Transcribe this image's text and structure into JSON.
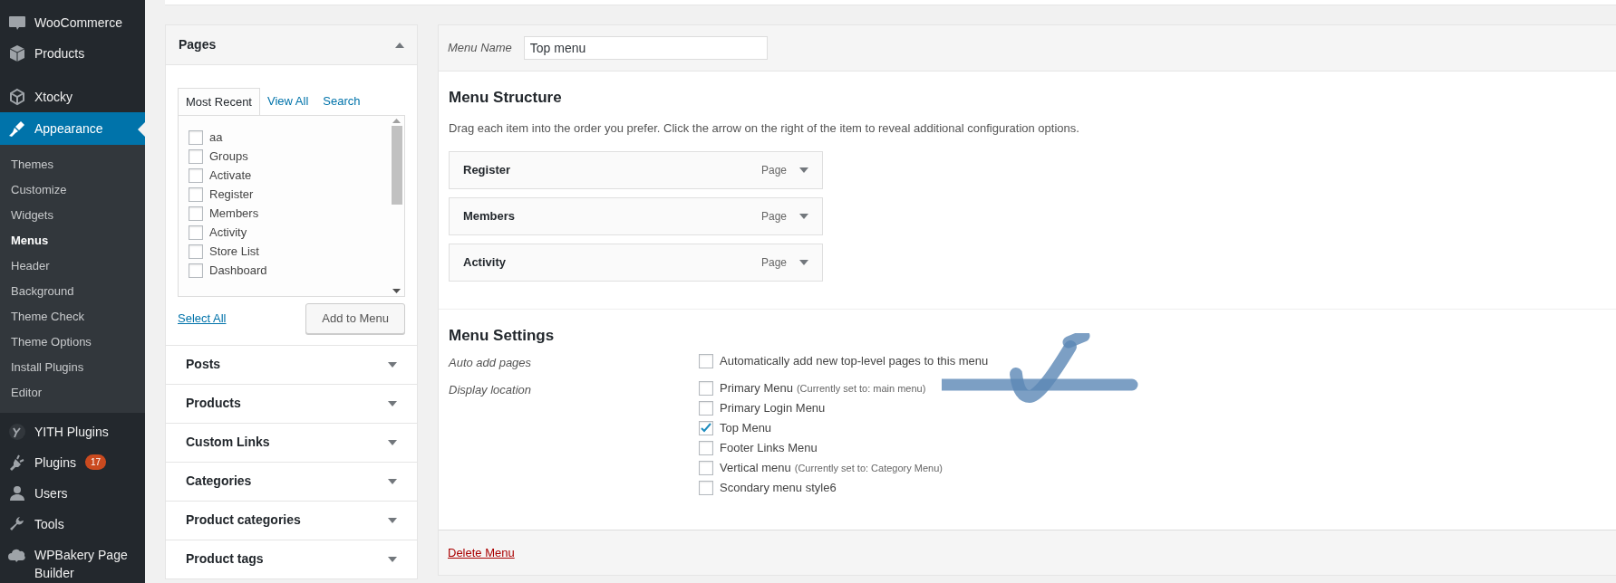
{
  "sidebar": {
    "items": [
      {
        "label": "WooCommerce",
        "selected": false
      },
      {
        "label": "Products",
        "selected": false
      },
      {
        "label": "Xtocky",
        "selected": false
      },
      {
        "label": "Appearance",
        "selected": true,
        "submenu": [
          {
            "label": "Themes",
            "selected": false
          },
          {
            "label": "Customize",
            "selected": false
          },
          {
            "label": "Widgets",
            "selected": false
          },
          {
            "label": "Menus",
            "selected": true
          },
          {
            "label": "Header",
            "selected": false
          },
          {
            "label": "Background",
            "selected": false
          },
          {
            "label": "Theme Check",
            "selected": false
          },
          {
            "label": "Theme Options",
            "selected": false
          },
          {
            "label": "Install Plugins",
            "selected": false
          },
          {
            "label": "Editor",
            "selected": false
          }
        ]
      },
      {
        "label": "YITH Plugins",
        "selected": false
      },
      {
        "label": "Plugins",
        "selected": false,
        "badge": "17"
      },
      {
        "label": "Users",
        "selected": false
      },
      {
        "label": "Tools",
        "selected": false
      },
      {
        "label": "WPBakery Page Builder",
        "selected": false
      }
    ]
  },
  "pages_box": {
    "title": "Pages",
    "expanded": true,
    "tabs": [
      {
        "label": "Most Recent",
        "selected": true
      },
      {
        "label": "View All",
        "selected": false
      },
      {
        "label": "Search",
        "selected": false
      }
    ],
    "items": [
      {
        "label": "aa",
        "checked": false
      },
      {
        "label": "Groups",
        "checked": false
      },
      {
        "label": "Activate",
        "checked": false
      },
      {
        "label": "Register",
        "checked": false
      },
      {
        "label": "Members",
        "checked": false
      },
      {
        "label": "Activity",
        "checked": false
      },
      {
        "label": "Store List",
        "checked": false
      },
      {
        "label": "Dashboard",
        "checked": false
      }
    ],
    "select_all": "Select All",
    "add_button": "Add to Menu"
  },
  "sections": [
    {
      "title": "Posts",
      "expanded": false
    },
    {
      "title": "Products",
      "expanded": false
    },
    {
      "title": "Custom Links",
      "expanded": false
    },
    {
      "title": "Categories",
      "expanded": false
    },
    {
      "title": "Product categories",
      "expanded": false
    },
    {
      "title": "Product tags",
      "expanded": false
    }
  ],
  "menu_name": {
    "label": "Menu Name",
    "value": "Top menu"
  },
  "structure": {
    "heading": "Menu Structure",
    "description": "Drag each item into the order you prefer. Click the arrow on the right of the item to reveal additional configuration options.",
    "items": [
      {
        "title": "Register",
        "type": "Page"
      },
      {
        "title": "Members",
        "type": "Page"
      },
      {
        "title": "Activity",
        "type": "Page"
      }
    ]
  },
  "settings": {
    "heading": "Menu Settings",
    "auto_add": {
      "label": "Auto add pages",
      "text": "Automatically add new top-level pages to this menu",
      "checked": false
    },
    "display_location": {
      "label": "Display location",
      "options": [
        {
          "label": "Primary Menu",
          "note": "(Currently set to: main menu)",
          "checked": false
        },
        {
          "label": "Primary Login Menu",
          "checked": false
        },
        {
          "label": "Top Menu",
          "checked": true
        },
        {
          "label": "Footer Links Menu",
          "checked": false
        },
        {
          "label": "Vertical menu",
          "note": "(Currently set to: Category Menu)",
          "checked": false
        },
        {
          "label": "Scondary menu style6",
          "checked": false
        }
      ]
    }
  },
  "delete_menu": "Delete Menu"
}
